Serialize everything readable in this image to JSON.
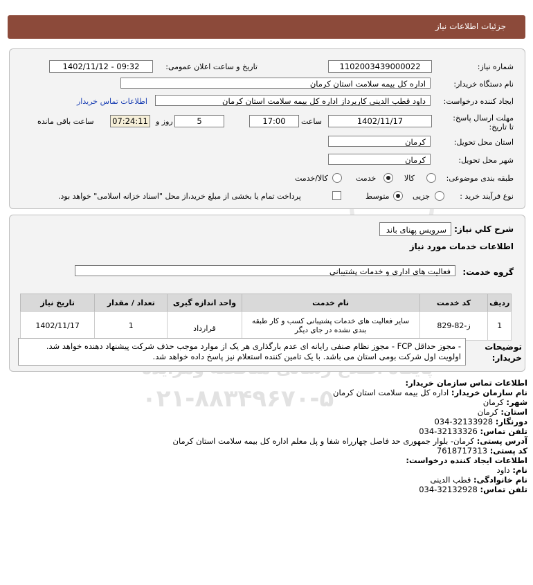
{
  "header": {
    "title": "جزئیات اطلاعات نیاز"
  },
  "fields": {
    "need_number_label": "شماره نیاز:",
    "need_number": "1102003439000022",
    "announce_label": "تاریخ و ساعت اعلان عمومی:",
    "announce_value": "1402/11/12 - 09:32",
    "buyer_label": "نام دستگاه خریدار:",
    "buyer_value": "اداره کل بیمه سلامت استان کرمان",
    "creator_label": "ایجاد کننده درخواست:",
    "creator_value": "داود قطب الدینی کارپرداز اداره کل بیمه سلامت استان کرمان",
    "contact_link": "اطلاعات تماس خریدار",
    "deadline_label": "مهلت ارسال پاسخ: تا تاریخ:",
    "deadline_date": "1402/11/17",
    "time_label": "ساعت",
    "deadline_time": "17:00",
    "days_value": "5",
    "days_label": "روز و",
    "remaining_time": "07:24:11",
    "remaining_label": "ساعت باقی مانده",
    "province_label": "استان محل تحویل:",
    "province_value": "کرمان",
    "city_label": "شهر محل تحویل:",
    "city_value": "کرمان",
    "category_label": "طبقه بندی موضوعی:",
    "category_options": [
      "کالا",
      "خدمت",
      "کالا/خدمت"
    ],
    "process_label": "نوع فرآیند خرید :",
    "process_options": [
      "جزیی",
      "متوسط"
    ],
    "payment_note": "پرداخت تمام یا بخشی از مبلغ خرید،از محل \"اسناد خزانه اسلامی\" خواهد بود."
  },
  "summary": {
    "label": "شرح کلي نياز:",
    "value": "سرویس پهنای باند",
    "section_title": "اطلاعات خدمات مورد نیاز",
    "group_label": "گروه خدمت:",
    "group_value": "فعالیت های اداری و خدمات پشتیبانی"
  },
  "table": {
    "headers": [
      "ردیف",
      "کد خدمت",
      "نام خدمت",
      "واحد اندازه گیری",
      "تعداد / مقدار",
      "تاریخ نیاز"
    ],
    "row": {
      "index": "1",
      "code": "ز-82-829",
      "name": "سایر فعالیت های خدمات پشتیبانی کسب و کار طبقه بندی نشده در جای دیگر",
      "unit": "قرارداد",
      "qty": "1",
      "date": "1402/11/17"
    }
  },
  "notes": {
    "label": "توضیحات خریدار:",
    "text": "- مجوز حداقل FCP - مجوز نظام صنفی رایانه ای عدم بارگذاری هر یک از موارد موجب حذف شرکت پیشنهاد دهنده خواهد شد. اولویت اول شرکت بومی استان می باشد. با یک تامین کننده استعلام نیز پاسخ داده خواهد شد."
  },
  "contact": {
    "org_title": "اطلاعات تماس سازمان خریدار:",
    "org_name_label": "نام سازمان خریدار:",
    "org_name": "اداره کل بیمه سلامت استان کرمان",
    "city_label": "شهر:",
    "city": "کرمان",
    "province_label": "استان:",
    "province": "کرمان",
    "fax_label": "دورنگار:",
    "fax": "034-32133928",
    "phone_label": "تلفن تماس:",
    "phone": "034-32133326",
    "address_label": "آدرس پستی:",
    "address": "کرمان- بلوار جمهوری حد فاصل چهارراه شفا و پل معلم اداره کل بیمه سلامت استان کرمان",
    "postal_label": "کد پستی:",
    "postal": "7618717313",
    "creator_title": "اطلاعات ایجاد کننده درخواست:",
    "first_name_label": "نام:",
    "first_name": "داود",
    "last_name_label": "نام خانوادگی:",
    "last_name": "قطب الدینی",
    "creator_phone_label": "تلفن تماس:",
    "creator_phone": "034-32132928"
  },
  "watermark": {
    "text": "ParsNamadData",
    "subtitle": "پایگاه اطلاع رسانی مناقصه ومزایده",
    "phone": "۰۲۱-۸۸۳۴۹۶۷۰-۵"
  }
}
